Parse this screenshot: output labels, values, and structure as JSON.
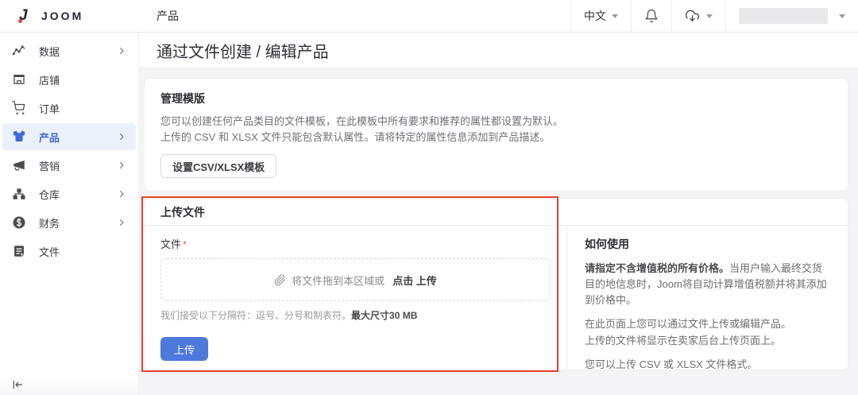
{
  "topbar": {
    "logo_text": "JOOM",
    "page_title": "产品",
    "language": "中文"
  },
  "sidebar": {
    "items": [
      {
        "label": "数据",
        "icon": "line-chart",
        "chevron": true,
        "active": false
      },
      {
        "label": "店铺",
        "icon": "storefront",
        "chevron": false,
        "active": false
      },
      {
        "label": "订单",
        "icon": "cart",
        "chevron": false,
        "active": false
      },
      {
        "label": "产品",
        "icon": "tshirt",
        "chevron": true,
        "active": true
      },
      {
        "label": "营销",
        "icon": "megaphone",
        "chevron": true,
        "active": false
      },
      {
        "label": "仓库",
        "icon": "warehouse",
        "chevron": true,
        "active": false
      },
      {
        "label": "财务",
        "icon": "finance",
        "chevron": true,
        "active": false
      },
      {
        "label": "文件",
        "icon": "file",
        "chevron": false,
        "active": false
      }
    ]
  },
  "page": {
    "title": "通过文件创建 / 编辑产品"
  },
  "template_card": {
    "title": "管理模版",
    "line1": "您可以创建任何产品类目的文件模板，在此模板中所有要求和推荐的属性都设置为默认。",
    "line2": "上传的 CSV 和 XLSX 文件只能包含默认属性。请将特定的属性信息添加到产品描述。",
    "button": "设置CSV/XLSX模板"
  },
  "upload_card": {
    "title": "上传文件",
    "file_label": "文件",
    "required_mark": "*",
    "dropzone_text": "将文件拖到本区域或",
    "dropzone_action": "点击 上传",
    "helper_text": "我们接受以下分隔符：逗号、分号和制表符。",
    "helper_bold": "最大尺寸30 MB",
    "upload_button": "上传"
  },
  "howto": {
    "title": "如何使用",
    "p1_bold": "请指定不含增值税的所有价格。",
    "p1_rest": "当用户输入最终交货目的地信息时，Joom将自动计算增值税额并将其添加到价格中。",
    "p2_line1": "在此页面上您可以通过文件上传或编辑产品。",
    "p2_line2": "上传的文件将显示在卖家后台上传页面上。",
    "p3": "您可以上传 CSV 或 XLSX 文件格式。"
  },
  "colors": {
    "accent_blue": "#4d79dd",
    "active_nav_blue": "#3f6ad8",
    "annotation_red": "#e8432e",
    "logo_navy": "#23253a",
    "logo_dot_red": "#e8432e"
  }
}
